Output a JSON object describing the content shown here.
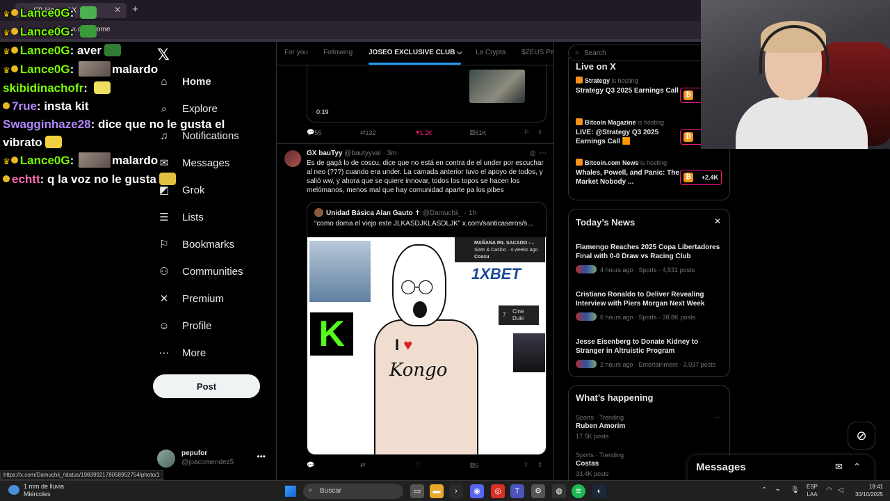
{
  "browser": {
    "tab_title": "(2) Home / X",
    "url": "x.com/home",
    "new_tab": "+",
    "tab_close": "✕",
    "nav_buttons": "← → ↻"
  },
  "chat": [
    {
      "user": "Lance0G",
      "color": "#7cfc00",
      "badges": "crown",
      "text": "",
      "emote": "#4caf50"
    },
    {
      "user": "Lance0G",
      "color": "#7cfc00",
      "badges": "crown",
      "text": "",
      "emote": "#3a9a3a"
    },
    {
      "user": "Lance0G",
      "color": "#7cfc00",
      "badges": "crown",
      "text": "aver",
      "emote": "#2e7d32"
    },
    {
      "user": "Lance0G",
      "color": "#7cfc00",
      "badges": "crown",
      "text": "malardo",
      "photo": true
    },
    {
      "user": "skibidinachofr",
      "color": "#7cfc00",
      "badges": "",
      "text": "",
      "emote": "#f0e060"
    },
    {
      "user": "7rue",
      "color": "#b388ff",
      "badges": "sub",
      "text": "insta kit"
    },
    {
      "user": "Swagginhaze28",
      "color": "#b388ff",
      "badges": "",
      "text": "dice que no le gusta el vibrato",
      "emote": "#f0d040"
    },
    {
      "user": "Lance0G",
      "color": "#7cfc00",
      "badges": "crown",
      "text": "malardo",
      "photo": true
    },
    {
      "user": "echtt",
      "color": "#ff69b4",
      "badges": "sub",
      "text": "q la voz no le gusta",
      "emote": "#e0c040"
    }
  ],
  "sidebar": {
    "logo": "𝕏",
    "items": [
      {
        "label": "Home",
        "icon": "⌂",
        "name": "home"
      },
      {
        "label": "Explore",
        "icon": "⌕",
        "name": "explore"
      },
      {
        "label": "Notifications",
        "icon": "♫",
        "name": "notifications"
      },
      {
        "label": "Messages",
        "icon": "✉",
        "name": "messages"
      },
      {
        "label": "Grok",
        "icon": "◩",
        "name": "grok"
      },
      {
        "label": "Lists",
        "icon": "☰",
        "name": "lists"
      },
      {
        "label": "Bookmarks",
        "icon": "⚐",
        "name": "bookmarks"
      },
      {
        "label": "Communities",
        "icon": "⚇",
        "name": "communities"
      },
      {
        "label": "Premium",
        "icon": "✕",
        "name": "premium"
      },
      {
        "label": "Profile",
        "icon": "☺",
        "name": "profile"
      },
      {
        "label": "More",
        "icon": "⋯",
        "name": "more"
      }
    ],
    "post_label": "Post",
    "profile": {
      "name": "pepufor",
      "handle": "@joacomendez5",
      "more": "•••"
    }
  },
  "main": {
    "tabs": [
      "For you",
      "Following",
      "JOSEO EXCLUSIVE CLUB",
      "La Crypta",
      "$ZEUS Pe"
    ],
    "active_tab": "JOSEO EXCLUSIVE CLUB",
    "dropdown_icon": "⌵",
    "video": {
      "time": "0:19"
    },
    "prev_actions": {
      "replies": "55",
      "reposts": "132",
      "likes": "1.2K",
      "views": "61K"
    },
    "tweet": {
      "name": "GX bauTyy",
      "handle": "@bautyyval",
      "time": "· 3m",
      "text": "Es de gagá lo de coscu, dice que no está en contra de el under por escuchar al neo (???) cuando era under. La camada anterior tuvo el apoyo de todos, y salió ww, y ahora que se quiere innovar, todos los topos se hacen los melómanos, menos mal que hay comunidad aparte pa los pibes",
      "quote": {
        "name": "Unidad Básica Alan Gauto ✝",
        "handle": "@Damuchii_",
        "time": "· 1h",
        "text": "“como doma el viejo este JLKASDJKLASDLJK” x.com/santicaseros/s..."
      },
      "meme": {
        "notif_title": "MAÑANA IRL SACADO -...",
        "notif_sub": "Slots & Casino · 4 weeks ago",
        "notif_user": "Coscu",
        "bet": "1XBET",
        "kick": "K",
        "cine": "Cine",
        "cine_sub": "Duki",
        "cine_num": "7",
        "love_i": "I",
        "heart": "♥",
        "sign": "Kongo",
        "glasses": "◯-◯"
      },
      "actions": {
        "replies": "",
        "reposts": "",
        "likes": "",
        "views": "6"
      }
    }
  },
  "right": {
    "search_placeholder": "Search",
    "live": {
      "title": "Live on X",
      "items": [
        {
          "host": "Strategy",
          "hosting": "is hosting",
          "title": "Strategy Q3 2025 Earnings Call",
          "count": "",
          "color": "#f7931a"
        },
        {
          "host": "Bitcoin Magazine",
          "hosting": "is hosting",
          "title": "LIVE: @Strategy Q3 2025 Earnings Call 🟧",
          "count": "",
          "color": "#f7931a"
        },
        {
          "host": "Bitcoin.com News",
          "hosting": "is hosting",
          "title": "Whales, Powell, and Panic: The Market Nobody ...",
          "count": "+2.4K",
          "color": "#f7931a"
        }
      ]
    },
    "news": {
      "title": "Today’s News",
      "close": "✕",
      "items": [
        {
          "title": "Flamengo Reaches 2025 Copa Libertadores Final with 0-0 Draw vs Racing Club",
          "meta": "4 hours ago · Sports · 4,531 posts"
        },
        {
          "title": "Cristiano Ronaldo to Deliver Revealing Interview with Piers Morgan Next Week",
          "meta": "6 hours ago · Sports · 38.8K posts"
        },
        {
          "title": "Jesse Eisenberg to Donate Kidney to Stranger in Altruistic Program",
          "meta": "2 hours ago · Entertainment · 3,037 posts"
        }
      ]
    },
    "happening": {
      "title": "What’s happening",
      "items": [
        {
          "category": "Sports · Trending",
          "name": "Ruben Amorim",
          "posts": "17.5K posts"
        },
        {
          "category": "Sports · Trending",
          "name": "Costas",
          "posts": "33.4K posts"
        }
      ]
    }
  },
  "messages_drawer": {
    "title": "Messages"
  },
  "status_link": "https://x.com/Damuchii_/status/1983992178058952754/photo/1",
  "taskbar": {
    "weather_line1": "1 mm de lluvia",
    "weather_line2": "Miércoles",
    "search": "Buscar",
    "lang1": "ESP",
    "lang2": "LAA",
    "time": "18:41",
    "date": "30/10/2025"
  }
}
